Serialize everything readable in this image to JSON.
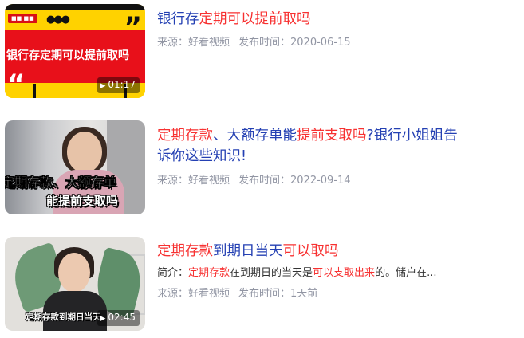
{
  "results": [
    {
      "title_parts": [
        {
          "text": "银行存",
          "hl": false
        },
        {
          "text": "定期可以提前取吗",
          "hl": true
        }
      ],
      "source": "来源：好看视频",
      "date": "发布时间：2020-06-15",
      "duration": "01:17",
      "thumb_text": [
        "银行存定期可以提前取吗"
      ]
    },
    {
      "title_parts": [
        {
          "text": "定期存款",
          "hl": true
        },
        {
          "text": "、大额存单能",
          "hl": false
        },
        {
          "text": "提前支取吗",
          "hl": true
        },
        {
          "text": "?银行小姐姐告诉你这些知识!",
          "hl": false
        }
      ],
      "source": "来源：好看视频",
      "date": "发布时间：2022-09-14",
      "thumb_text": [
        "定期存款、大额存单",
        "能提前支取吗"
      ]
    },
    {
      "title_parts": [
        {
          "text": "定期存款",
          "hl": true
        },
        {
          "text": "到期日当天",
          "hl": false
        },
        {
          "text": "可以取吗",
          "hl": true
        }
      ],
      "desc_parts": [
        {
          "text": "简介：",
          "hl": false
        },
        {
          "text": "定期存款",
          "hl": true
        },
        {
          "text": "在到期日的当天是",
          "hl": false
        },
        {
          "text": "可以支取出来",
          "hl": true
        },
        {
          "text": "的。储户在...",
          "hl": false
        }
      ],
      "source": "来源：好看视频",
      "date": "发布时间：1天前",
      "duration": "02:45",
      "thumb_text": [
        "定期存款到期日当天"
      ]
    }
  ],
  "colors": {
    "title_link": "#2440b3",
    "highlight": "#f73131",
    "meta": "#9195a3"
  },
  "icons": {
    "play": "play-icon"
  }
}
